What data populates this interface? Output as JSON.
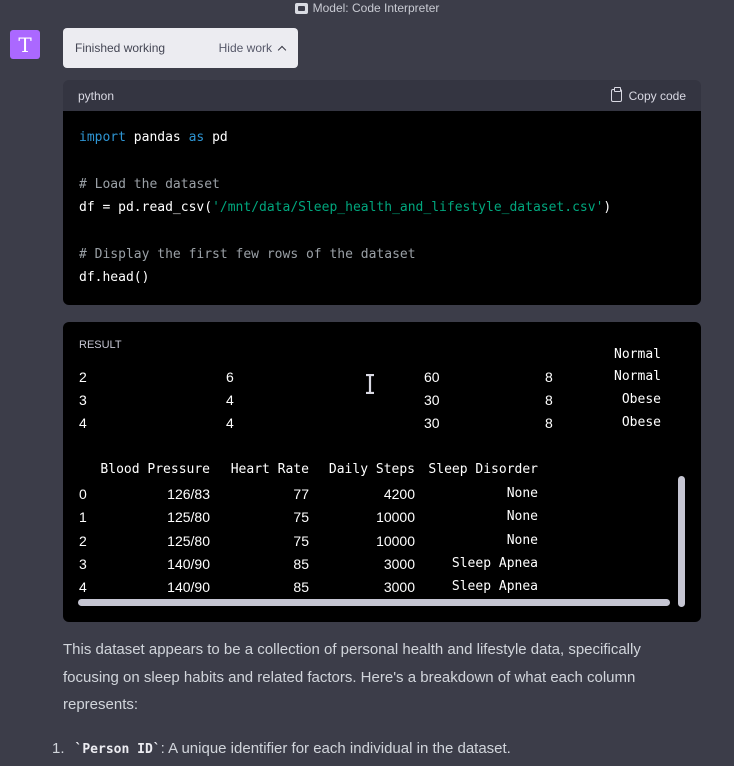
{
  "model_bar": {
    "icon": "model-plugin-icon",
    "label": "Model: Code Interpreter"
  },
  "avatar": {
    "letter": "T",
    "color": "#ab68ff"
  },
  "status": {
    "label": "Finished working",
    "hide_label": "Hide work"
  },
  "code_block": {
    "language": "python",
    "copy_label": "Copy code",
    "lines": [
      {
        "parts": [
          {
            "t": "import",
            "c": "kw"
          },
          {
            "t": " pandas ",
            "c": ""
          },
          {
            "t": "as",
            "c": "kw"
          },
          {
            "t": " pd",
            "c": ""
          }
        ]
      },
      {
        "parts": [
          {
            "t": "# Load the dataset",
            "c": "cm"
          }
        ]
      },
      {
        "parts": [
          {
            "t": "df = pd.read_csv(",
            "c": ""
          },
          {
            "t": "'/mnt/data/Sleep_health_and_lifestyle_dataset.csv'",
            "c": "st"
          },
          {
            "t": ")",
            "c": ""
          }
        ]
      },
      {
        "parts": [
          {
            "t": "# Display the first few rows of the dataset",
            "c": "cm"
          }
        ]
      },
      {
        "parts": [
          {
            "t": "df.head()",
            "c": ""
          }
        ]
      }
    ]
  },
  "result": {
    "label": "RESULT",
    "top_rows": [
      {
        "idx": "2",
        "a": "6",
        "b": "60",
        "c": "8",
        "d": "Normal"
      },
      {
        "idx": "3",
        "a": "4",
        "b": "30",
        "c": "8",
        "d": "Obese"
      },
      {
        "idx": "4",
        "a": "4",
        "b": "30",
        "c": "8",
        "d": "Obese"
      }
    ],
    "clipped_row_fragment": {
      "d": "Normal"
    },
    "columns": [
      "Blood Pressure",
      "Heart Rate",
      "Daily Steps",
      "Sleep Disorder"
    ],
    "rows": [
      {
        "idx": "0",
        "bp": "126/83",
        "hr": "77",
        "steps": "4200",
        "disorder": "None"
      },
      {
        "idx": "1",
        "bp": "125/80",
        "hr": "75",
        "steps": "10000",
        "disorder": "None"
      },
      {
        "idx": "2",
        "bp": "125/80",
        "hr": "75",
        "steps": "10000",
        "disorder": "None"
      },
      {
        "idx": "3",
        "bp": "140/90",
        "hr": "85",
        "steps": "3000",
        "disorder": "Sleep Apnea"
      },
      {
        "idx": "4",
        "bp": "140/90",
        "hr": "85",
        "steps": "3000",
        "disorder": "Sleep Apnea"
      }
    ]
  },
  "explanation": {
    "paragraph": "This dataset appears to be a collection of personal health and lifestyle data, specifically focusing on sleep habits and related factors. Here's a breakdown of what each column represents:",
    "list": [
      {
        "number": "1.",
        "code": "`Person ID`",
        "text": ": A unique identifier for each individual in the dataset."
      }
    ]
  }
}
